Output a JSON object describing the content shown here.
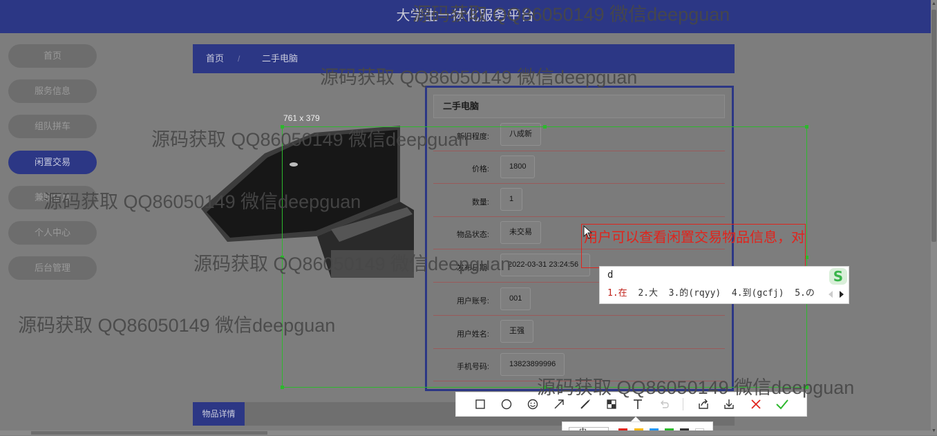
{
  "header": {
    "site_title": "大学生一体化服务平台"
  },
  "sidebar": {
    "items": [
      {
        "label": "首页",
        "active": false
      },
      {
        "label": "服务信息",
        "active": false
      },
      {
        "label": "组队拼车",
        "active": false
      },
      {
        "label": "闲置交易",
        "active": true
      },
      {
        "label": "兼职信息",
        "active": false
      },
      {
        "label": "个人中心",
        "active": false
      },
      {
        "label": "后台管理",
        "active": false
      }
    ]
  },
  "breadcrumb": {
    "home": "首页",
    "separator": "/",
    "current": "二手电脑"
  },
  "detail": {
    "title": "二手电脑",
    "fields": [
      {
        "label": "新旧程度:",
        "value": "八成新"
      },
      {
        "label": "价格:",
        "value": "1800"
      },
      {
        "label": "数量:",
        "value": "1"
      },
      {
        "label": "物品状态:",
        "value": "未交易"
      },
      {
        "label": "发布日期:",
        "value": "2022-03-31 23:24:56"
      },
      {
        "label": "用户账号:",
        "value": "001"
      },
      {
        "label": "用户姓名:",
        "value": "王强"
      },
      {
        "label": "手机号码:",
        "value": "13823899996"
      }
    ]
  },
  "info_tab": {
    "label": "物品详情"
  },
  "screenshot_tool": {
    "selection_size": "761 x 379",
    "annotation_text": "用户可以查看闲置交易物品信息，对",
    "tools": [
      "rectangle-icon",
      "ellipse-icon",
      "emoji-icon",
      "arrow-icon",
      "pen-icon",
      "mosaic-icon",
      "text-icon",
      "undo-icon",
      "share-icon",
      "download-icon",
      "cancel-icon",
      "confirm-icon"
    ],
    "size_option": "中",
    "colors": [
      "#e0241c",
      "#f5b800",
      "#2196f3",
      "#2db82d",
      "#333333",
      "#ffffff"
    ]
  },
  "ime": {
    "composition": "d",
    "candidates": [
      "1.在",
      "2.大",
      "3.的(rqyy)",
      "4.到(gcfj)",
      "5.の"
    ]
  },
  "watermark": {
    "text": "源码获取 QQ86050149 微信deepguan"
  },
  "colors": {
    "brand": "#2c3785",
    "annotation": "#e0241c",
    "selection": "#2db82d",
    "confirm": "#2db82d",
    "cancel": "#e0241c"
  }
}
